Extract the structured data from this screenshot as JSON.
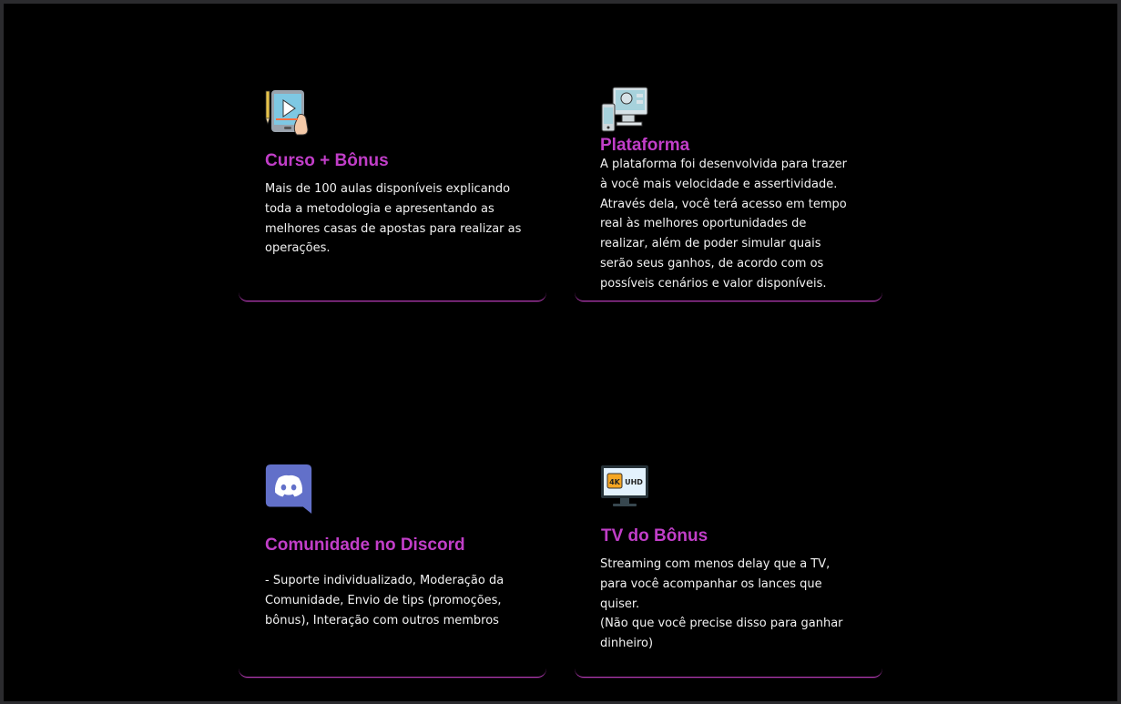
{
  "cards": [
    {
      "icon": "video-lesson-tablet-icon",
      "title": "Curso + Bônus",
      "text": "Mais de 100 aulas disponíveis explicando toda a metodologia e apresentando as melhores casas de apostas para realizar as operações."
    },
    {
      "icon": "multi-device-platform-icon",
      "title": "Plataforma",
      "text": "A plataforma foi desenvolvida para trazer à você mais velocidade e assertividade. Através dela, você terá acesso em tempo real às melhores oportunidades de realizar, além de poder simular quais serão seus ganhos, de acordo com os possíveis cenários e valor disponíveis."
    },
    {
      "icon": "discord-icon",
      "title": "Comunidade no Discord",
      "text": "- Suporte individualizado, Moderação da Comunidade, Envio de tips (promoções, bônus), Interação com outros membros"
    },
    {
      "icon": "tv-4k-uhd-icon",
      "title": "TV do Bônus",
      "text": "Streaming com menos delay que a TV, para você acompanhar os lances que quiser.\n(Não que você precise disso para ganhar dinheiro)"
    }
  ]
}
